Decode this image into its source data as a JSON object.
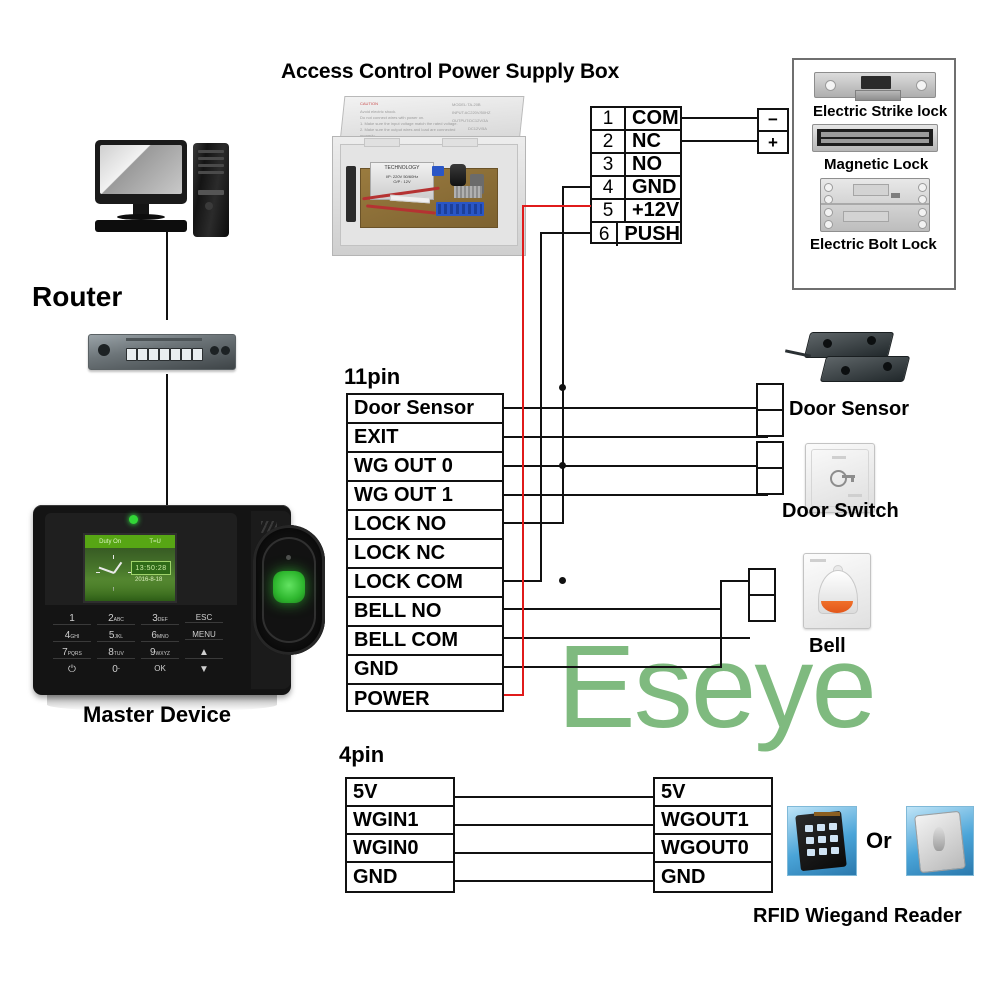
{
  "diagram": {
    "title": "Access Control Power Supply Box",
    "watermark": "Eseye"
  },
  "left_column": {
    "router_label": "Router",
    "master_device_label": "Master Device",
    "pc_icon": "desktop-computer-icon",
    "router_icon": "network-router-icon",
    "device": {
      "lcd_tab_left": "Duty On",
      "lcd_tab_right": "T=U",
      "lcd_time": "13:50:28",
      "lcd_date": "2016-8-18",
      "keys": [
        {
          "main": "1",
          "sub": ""
        },
        {
          "main": "2",
          "sub": "ABC"
        },
        {
          "main": "3",
          "sub": "DEF"
        },
        {
          "main": "ESC",
          "sub": ""
        },
        {
          "main": "4",
          "sub": "GHI"
        },
        {
          "main": "5",
          "sub": "JKL"
        },
        {
          "main": "6",
          "sub": "MNO"
        },
        {
          "main": "MENU",
          "sub": ""
        },
        {
          "main": "7",
          "sub": "PQRS"
        },
        {
          "main": "8",
          "sub": "TUV"
        },
        {
          "main": "9",
          "sub": "WXYZ"
        },
        {
          "main": "▲",
          "sub": ""
        },
        {
          "main": "⏻",
          "sub": ""
        },
        {
          "main": "0",
          "sub": "⌴"
        },
        {
          "main": "OK",
          "sub": ""
        },
        {
          "main": "▼",
          "sub": ""
        }
      ]
    }
  },
  "power_supply": {
    "box_caption": "Access Control Power Supply Box",
    "box_print": {
      "caution": "CAUTION",
      "model": "MODEL:TA-20B",
      "input": "INPUT:AC220V/50HZ",
      "output1": "OUTPUT:DC12V/3A",
      "output2": "DC12V/5A",
      "transformer": "TECHNOLOGY"
    },
    "terminals": [
      {
        "num": "1",
        "name": "COM"
      },
      {
        "num": "2",
        "name": "NC"
      },
      {
        "num": "3",
        "name": "NO"
      },
      {
        "num": "4",
        "name": "GND"
      },
      {
        "num": "5",
        "name": "+12V"
      },
      {
        "num": "6",
        "name": "PUSH"
      }
    ],
    "lock_connector": [
      {
        "label": "−"
      },
      {
        "label": "+"
      }
    ]
  },
  "locks_panel": {
    "items": [
      {
        "label": "Electric Strike lock",
        "icon": "electric-strike-lock-image"
      },
      {
        "label": "Magnetic Lock",
        "icon": "magnetic-lock-image"
      },
      {
        "label": "Electric Bolt Lock",
        "icon": "electric-bolt-lock-image"
      }
    ]
  },
  "main_block": {
    "label": "11pin",
    "pins": [
      {
        "name": "Door Sensor"
      },
      {
        "name": "EXIT"
      },
      {
        "name": "WG OUT 0"
      },
      {
        "name": "WG OUT 1"
      },
      {
        "name": "LOCK NO"
      },
      {
        "name": "LOCK NC"
      },
      {
        "name": "LOCK COM"
      },
      {
        "name": "BELL NO"
      },
      {
        "name": "BELL COM"
      },
      {
        "name": "GND"
      },
      {
        "name": "POWER"
      }
    ]
  },
  "wiegand_block": {
    "label": "4pin",
    "left_pins": [
      {
        "name": "5V"
      },
      {
        "name": "WGIN1"
      },
      {
        "name": "WGIN0"
      },
      {
        "name": "GND"
      }
    ],
    "right_pins": [
      {
        "name": "5V"
      },
      {
        "name": "WGOUT1"
      },
      {
        "name": "WGOUT0"
      },
      {
        "name": "GND"
      }
    ],
    "reader_caption": "RFID Wiegand Reader",
    "or_label": "Or"
  },
  "peripherals": {
    "door_sensor_label": "Door Sensor",
    "door_switch_label": "Door Switch",
    "bell_label": "Bell"
  },
  "colors": {
    "wire_black": "#111111",
    "wire_red": "#e01b1b",
    "watermark_green": "#7fba7f"
  }
}
